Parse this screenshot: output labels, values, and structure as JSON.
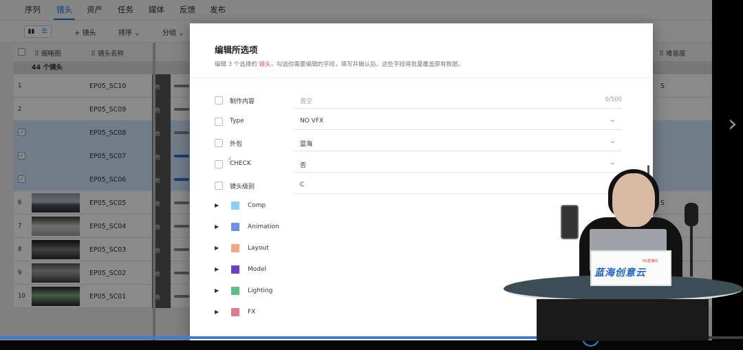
{
  "app": {
    "nav_tabs": [
      {
        "label": "序列"
      },
      {
        "label": "镜头"
      },
      {
        "label": "资产"
      },
      {
        "label": "任务"
      },
      {
        "label": "媒体"
      },
      {
        "label": "反馈"
      },
      {
        "label": "发布"
      }
    ],
    "active_tab": 1,
    "toolbar": {
      "add_shot": "+ 镜头",
      "sort": "排序 ⌄",
      "group": "分组 ⌄"
    },
    "table": {
      "header_thumb": "⠿ 缩略图",
      "header_name": "⠿ 镜头名称",
      "header_difficulty": "⠿ 难易度",
      "group_label": "44 个镜头",
      "rows": [
        {
          "index": "1",
          "name": "EP05_SC10",
          "status": "始",
          "selected": false,
          "thumb": "",
          "difficulty": "S",
          "bar": "gray"
        },
        {
          "index": "2",
          "name": "EP05_SC09",
          "status": "始",
          "selected": false,
          "thumb": "",
          "difficulty": "",
          "bar": "gray"
        },
        {
          "index": "",
          "name": "EP05_SC08",
          "status": "始",
          "selected": true,
          "thumb": "",
          "difficulty": "",
          "bar": "gray"
        },
        {
          "index": "",
          "name": "EP05_SC07",
          "status": "始",
          "selected": true,
          "thumb": "",
          "difficulty": "",
          "bar": "blue"
        },
        {
          "index": "",
          "name": "EP05_SC06",
          "status": "始",
          "selected": true,
          "thumb": "",
          "difficulty": "",
          "bar": "blue"
        },
        {
          "index": "6",
          "name": "EP05_SC05",
          "status": "始",
          "selected": false,
          "thumb": "city",
          "difficulty": "S",
          "bar": "gray"
        },
        {
          "index": "7",
          "name": "EP05_SC04",
          "status": "始",
          "selected": false,
          "thumb": "room",
          "difficulty": "",
          "bar": "gray"
        },
        {
          "index": "8",
          "name": "EP05_SC03",
          "status": "始",
          "selected": false,
          "thumb": "road",
          "difficulty": "",
          "bar": "gray"
        },
        {
          "index": "9",
          "name": "EP05_SC02",
          "status": "始",
          "selected": false,
          "thumb": "street",
          "difficulty": "",
          "bar": "gray"
        },
        {
          "index": "10",
          "name": "EP05_SC01",
          "status": "始",
          "selected": false,
          "thumb": "screen",
          "difficulty": "",
          "bar": "gray"
        }
      ]
    }
  },
  "modal": {
    "title": "编辑所选项",
    "subtitle_pre": "编辑 3 个选择的 ",
    "subtitle_hl": "镜头",
    "subtitle_post": "，勾选你需要编辑的字段，填写并确认后，这些字段将批量覆盖原有数据。",
    "fields": [
      {
        "label": "制作内容",
        "value": "置空",
        "placeholder": true,
        "count": "0/500",
        "dropdown": false
      },
      {
        "label": "Type",
        "value": "NO VFX",
        "placeholder": false,
        "count": "",
        "dropdown": true
      },
      {
        "label": "外包",
        "value": "蓝海",
        "placeholder": false,
        "count": "",
        "dropdown": true
      },
      {
        "label": "CHECK",
        "value": "否",
        "placeholder": false,
        "count": "",
        "dropdown": true
      },
      {
        "label": "镜头级别",
        "value": "C",
        "placeholder": false,
        "count": "",
        "dropdown": true
      }
    ],
    "categories": [
      {
        "label": "Comp",
        "color": "#8ecdf5"
      },
      {
        "label": "Animation",
        "color": "#6f8fe0"
      },
      {
        "label": "Layout",
        "color": "#f2a784"
      },
      {
        "label": "Model",
        "color": "#6a3fc6"
      },
      {
        "label": "Lighting",
        "color": "#5cbf8a"
      },
      {
        "label": "FX",
        "color": "#e07a8e"
      }
    ]
  },
  "video": {
    "progress_fraction": 0.795
  },
  "presenter_sign": {
    "logo": "蓝海创意云",
    "badge": "5G直播间"
  },
  "colors": {
    "accent": "#1a73e8",
    "selected_row": "#cfe6fb",
    "highlight": "#e0505a"
  }
}
